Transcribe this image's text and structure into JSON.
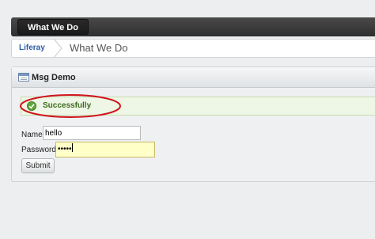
{
  "nav": {
    "tab_label": "What We Do"
  },
  "breadcrumb": {
    "root": "Liferay",
    "current": "What We Do"
  },
  "portlet": {
    "title": "Msg Demo",
    "icon": "portlet-window-icon"
  },
  "message": {
    "text": "Successfully",
    "icon": "check-circle-icon",
    "color": "#3c6a1f"
  },
  "form": {
    "name_label": "Name:",
    "name_value": "hello",
    "password_label": "Password:",
    "password_value": "•••••",
    "submit_label": "Submit"
  },
  "colors": {
    "annotation": "#d0141b",
    "success_bg": "#eef7e5",
    "focus_bg": "#ffffc8",
    "link": "#2c5da7"
  }
}
